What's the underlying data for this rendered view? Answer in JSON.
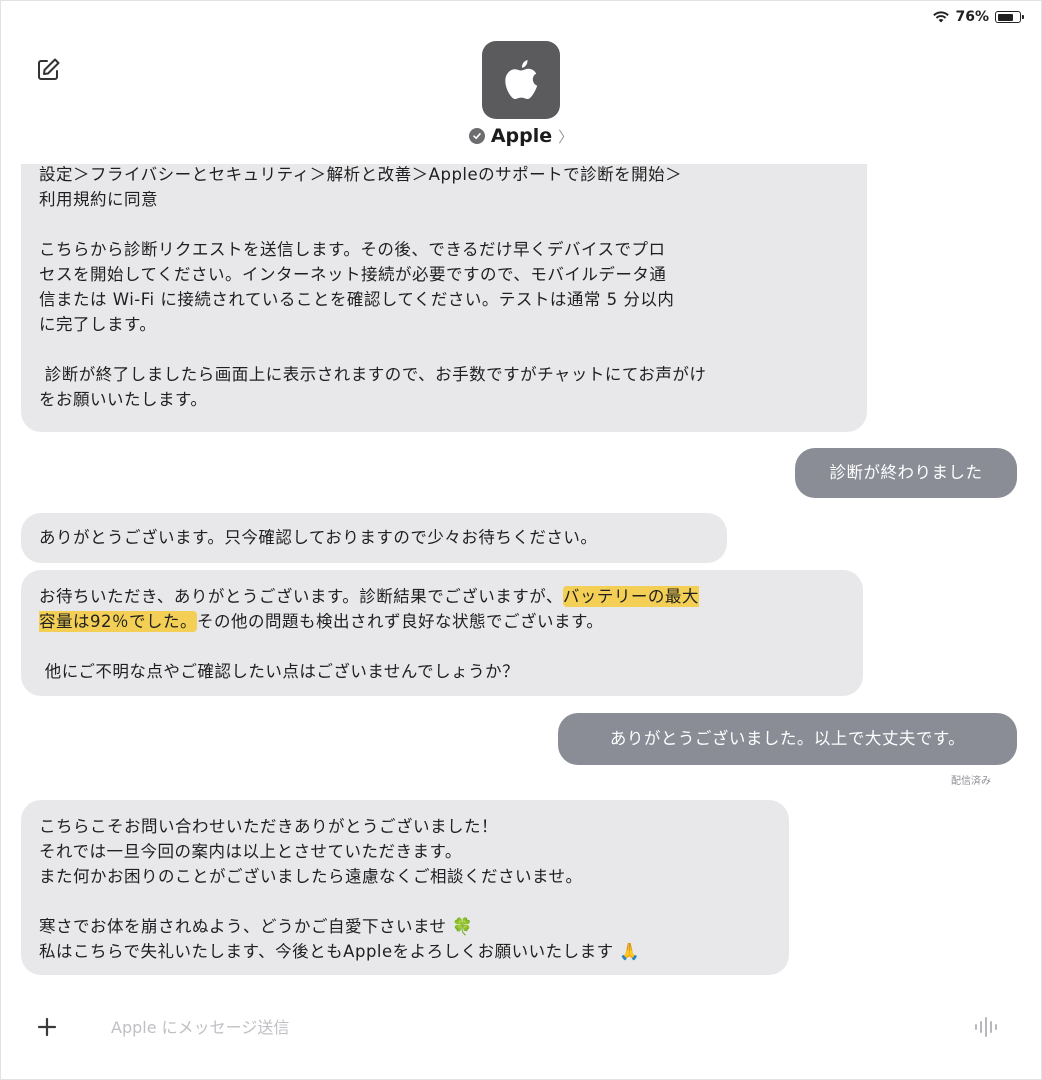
{
  "status_bar": {
    "battery_percent": "76%",
    "battery_level": 0.76
  },
  "header": {
    "contact_name": "Apple",
    "chevron": "〉"
  },
  "messages": {
    "m1": "設定＞フライバシーとセキュリティ＞解析と改善＞Appleのサポートで診断を開始＞\n利用規約に同意\n\nこちらから診断リクエストを送信します。その後、できるだけ早くデバイスでプロ\nセスを開始してください。インターネット接続が必要ですので、モバイルデータ通\n信または Wi-Fi に接続されていることを確認してください。テストは通常 5 分以内\nに完了します。\n\n 診断が終了しましたら画面上に表示されますので、お手数ですがチャットにてお声がけ\nをお願いいたします。",
    "m2": "診断が終わりました",
    "m3": "ありがとうございます。只今確認しておりますので少々お待ちください。",
    "m4_part1": "お待ちいただき、ありがとうございます。診断結果でございますが、",
    "m4_highlight": "バッテリーの最大\n容量は92％でした。",
    "m4_part2": "その他の問題も検出されず良好な状態でございます。\n\n 他にご不明な点やご確認したい点はございませんでしょうか？",
    "m5": "ありがとうございました。以上で大丈夫です。",
    "read_receipt": "配信済み",
    "m6": "こちらこそお問い合わせいただきありがとうございました！\nそれでは一旦今回の案内は以上とさせていただきます。\nまた何かお困りのことがございましたら遠慮なくご相談くださいませ。\n\n寒さでお体を崩されぬよう、どうかご自愛下さいませ 🍀\n私はこちらで失礼いたします、今後ともAppleをよろしくお願いいたします 🙏"
  },
  "input": {
    "placeholder": "Apple にメッセージ送信"
  },
  "icons": {
    "compose": "compose-icon",
    "wifi": "wifi-icon",
    "battery": "battery-icon",
    "apple_logo": "apple-logo-icon",
    "verified": "verified-badge-icon",
    "plus": "plus-icon",
    "voice": "waveform-icon"
  },
  "colors": {
    "incoming_bubble": "#e8e8ea",
    "outgoing_bubble": "#8a8d96",
    "highlight": "#f3cf55",
    "avatar": "#5b5b5d"
  }
}
